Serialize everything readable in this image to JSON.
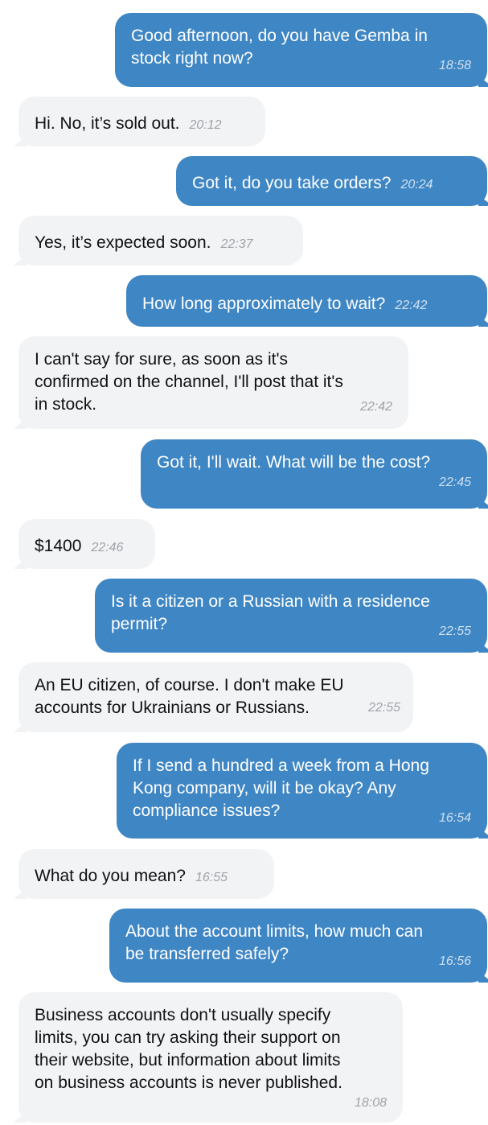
{
  "messages": [
    {
      "direction": "outgoing",
      "text": "Good afternoon, do you have Gemba in\nstock right now?",
      "time": "18:58"
    },
    {
      "direction": "incoming",
      "text": "Hi. No, it’s sold out.",
      "time": "20:12"
    },
    {
      "direction": "outgoing",
      "text": "Got it, do you take orders?",
      "time": "20:24"
    },
    {
      "direction": "incoming",
      "text": "Yes, it’s expected soon.",
      "time": "22:37"
    },
    {
      "direction": "outgoing",
      "text": "How long approximately to wait?",
      "time": "22:42"
    },
    {
      "direction": "incoming",
      "text": "I can't say for sure, as soon as it's\nconfirmed on the channel, I'll post that it's\nin stock.",
      "time": "22:42"
    },
    {
      "direction": "outgoing",
      "text": "Got it, I'll wait. What will be the cost?",
      "time": "22:45"
    },
    {
      "direction": "incoming",
      "text": "$1400",
      "time": "22:46"
    },
    {
      "direction": "outgoing",
      "text": "Is it a citizen or a Russian with a residence\npermit?",
      "time": "22:55"
    },
    {
      "direction": "incoming",
      "text": "An EU citizen, of course. I don't make EU\naccounts for Ukrainians or Russians.",
      "time": "22:55"
    },
    {
      "direction": "outgoing",
      "text": "If I send a hundred a week from a Hong\nKong company, will it be okay? Any\ncompliance issues?",
      "time": "16:54"
    },
    {
      "direction": "incoming",
      "text": "What do you mean?",
      "time": "16:55"
    },
    {
      "direction": "outgoing",
      "text": "About the account limits, how much can\nbe transferred safely?",
      "time": "16:56"
    },
    {
      "direction": "incoming",
      "text": "Business accounts don't usually specify\nlimits, you can try asking their support on\ntheir website, but information about limits\non business accounts is never published.",
      "time": "18:08"
    }
  ],
  "colors": {
    "outgoing_bubble": "#3f86c4",
    "incoming_bubble": "#f2f3f5",
    "outgoing_text": "#ffffff",
    "incoming_text": "#111111"
  }
}
